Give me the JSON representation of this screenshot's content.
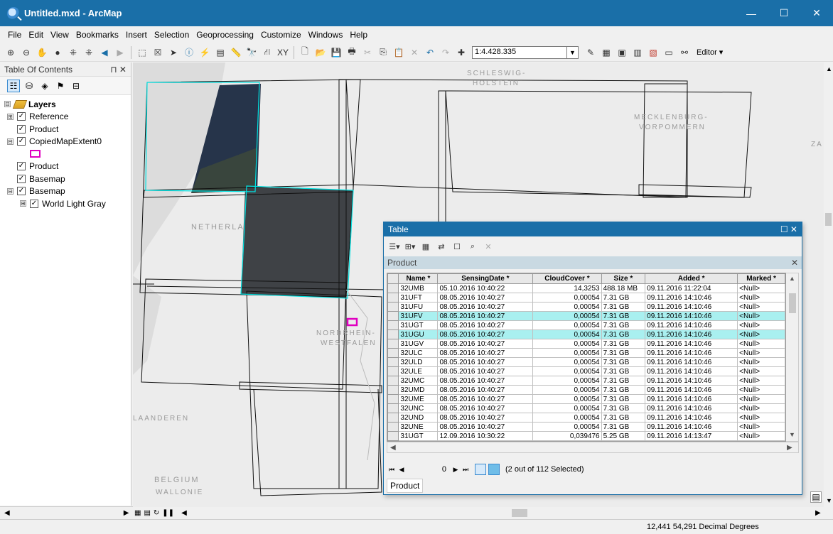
{
  "window": {
    "title": "Untitled.mxd - ArcMap",
    "minimize": "—",
    "maximize": "☐",
    "close": "✕"
  },
  "menu": [
    "File",
    "Edit",
    "View",
    "Bookmarks",
    "Insert",
    "Selection",
    "Geoprocessing",
    "Customize",
    "Windows",
    "Help"
  ],
  "toolbar": {
    "scale": "1:4.428.335",
    "editor_label": "Editor ▾"
  },
  "toc": {
    "title": "Table Of Contents",
    "pin": "⊓ ✕",
    "items": [
      {
        "label": "Layers",
        "expand": "⊟"
      },
      {
        "label": "Reference",
        "expand": "⊞",
        "checked": "✓"
      },
      {
        "label": "Product",
        "checked": "✓"
      },
      {
        "label": "CopiedMapExtent0",
        "expand": "⊟",
        "checked": "✓"
      },
      {
        "label": "Product",
        "checked": "✓"
      },
      {
        "label": "Basemap",
        "checked": "✓"
      },
      {
        "label": "Basemap",
        "expand": "⊟",
        "checked": "✓"
      },
      {
        "label": "World Light Gray",
        "expand": "⊞",
        "checked": "✓"
      }
    ]
  },
  "map": {
    "places": [
      "SCHLESWIG-",
      "HOLSTEIN",
      "MECKLENBURG-",
      "VORPOMMERN",
      "NETHERLA",
      "NORDRHEIN-",
      "WESTFALEN",
      "LAANDEREN",
      "BELGIUM",
      "WALLONIE",
      "ZA"
    ]
  },
  "table": {
    "title": "Table",
    "close": "☐ ✕",
    "tab": "Product",
    "columns": [
      "Name *",
      "SensingDate *",
      "CloudCover *",
      "Size *",
      "Added *",
      "Marked *"
    ],
    "rows": [
      {
        "name": "32UMB",
        "date": "05.10.2016 10:40:22",
        "cloud": "14,3253",
        "size": "488.18 MB",
        "added": "09.11.2016 11:22:04",
        "marked": "<Null>",
        "selected": false
      },
      {
        "name": "31UFT",
        "date": "08.05.2016 10:40:27",
        "cloud": "0,00054",
        "size": "7.31 GB",
        "added": "09.11.2016 14:10:46",
        "marked": "<Null>",
        "selected": false
      },
      {
        "name": "31UFU",
        "date": "08.05.2016 10:40:27",
        "cloud": "0,00054",
        "size": "7.31 GB",
        "added": "09.11.2016 14:10:46",
        "marked": "<Null>",
        "selected": false
      },
      {
        "name": "31UFV",
        "date": "08.05.2016 10:40:27",
        "cloud": "0,00054",
        "size": "7.31 GB",
        "added": "09.11.2016 14:10:46",
        "marked": "<Null>",
        "selected": true
      },
      {
        "name": "31UGT",
        "date": "08.05.2016 10:40:27",
        "cloud": "0,00054",
        "size": "7.31 GB",
        "added": "09.11.2016 14:10:46",
        "marked": "<Null>",
        "selected": false
      },
      {
        "name": "31UGU",
        "date": "08.05.2016 10:40:27",
        "cloud": "0,00054",
        "size": "7.31 GB",
        "added": "09.11.2016 14:10:46",
        "marked": "<Null>",
        "selected": true
      },
      {
        "name": "31UGV",
        "date": "08.05.2016 10:40:27",
        "cloud": "0,00054",
        "size": "7.31 GB",
        "added": "09.11.2016 14:10:46",
        "marked": "<Null>",
        "selected": false
      },
      {
        "name": "32ULC",
        "date": "08.05.2016 10:40:27",
        "cloud": "0,00054",
        "size": "7.31 GB",
        "added": "09.11.2016 14:10:46",
        "marked": "<Null>",
        "selected": false
      },
      {
        "name": "32ULD",
        "date": "08.05.2016 10:40:27",
        "cloud": "0,00054",
        "size": "7.31 GB",
        "added": "09.11.2016 14:10:46",
        "marked": "<Null>",
        "selected": false
      },
      {
        "name": "32ULE",
        "date": "08.05.2016 10:40:27",
        "cloud": "0,00054",
        "size": "7.31 GB",
        "added": "09.11.2016 14:10:46",
        "marked": "<Null>",
        "selected": false
      },
      {
        "name": "32UMC",
        "date": "08.05.2016 10:40:27",
        "cloud": "0,00054",
        "size": "7.31 GB",
        "added": "09.11.2016 14:10:46",
        "marked": "<Null>",
        "selected": false
      },
      {
        "name": "32UMD",
        "date": "08.05.2016 10:40:27",
        "cloud": "0,00054",
        "size": "7.31 GB",
        "added": "09.11.2016 14:10:46",
        "marked": "<Null>",
        "selected": false
      },
      {
        "name": "32UME",
        "date": "08.05.2016 10:40:27",
        "cloud": "0,00054",
        "size": "7.31 GB",
        "added": "09.11.2016 14:10:46",
        "marked": "<Null>",
        "selected": false
      },
      {
        "name": "32UNC",
        "date": "08.05.2016 10:40:27",
        "cloud": "0,00054",
        "size": "7.31 GB",
        "added": "09.11.2016 14:10:46",
        "marked": "<Null>",
        "selected": false
      },
      {
        "name": "32UND",
        "date": "08.05.2016 10:40:27",
        "cloud": "0,00054",
        "size": "7.31 GB",
        "added": "09.11.2016 14:10:46",
        "marked": "<Null>",
        "selected": false
      },
      {
        "name": "32UNE",
        "date": "08.05.2016 10:40:27",
        "cloud": "0,00054",
        "size": "7.31 GB",
        "added": "09.11.2016 14:10:46",
        "marked": "<Null>",
        "selected": false
      },
      {
        "name": "31UGT",
        "date": "12.09.2016 10:30:22",
        "cloud": "0,039476",
        "size": "5.25 GB",
        "added": "09.11.2016 14:13:47",
        "marked": "<Null>",
        "selected": false
      }
    ],
    "nav": {
      "record": "0",
      "status": "(2 out of 112 Selected)"
    },
    "bottom_tab": "Product"
  },
  "status": {
    "coords": "12,441  54,291 Decimal Degrees"
  },
  "colors": {
    "accent": "#1a6fa8",
    "selection": "#a9f0f0",
    "footprint": "#00e0e0",
    "extent": "#e000c0"
  }
}
